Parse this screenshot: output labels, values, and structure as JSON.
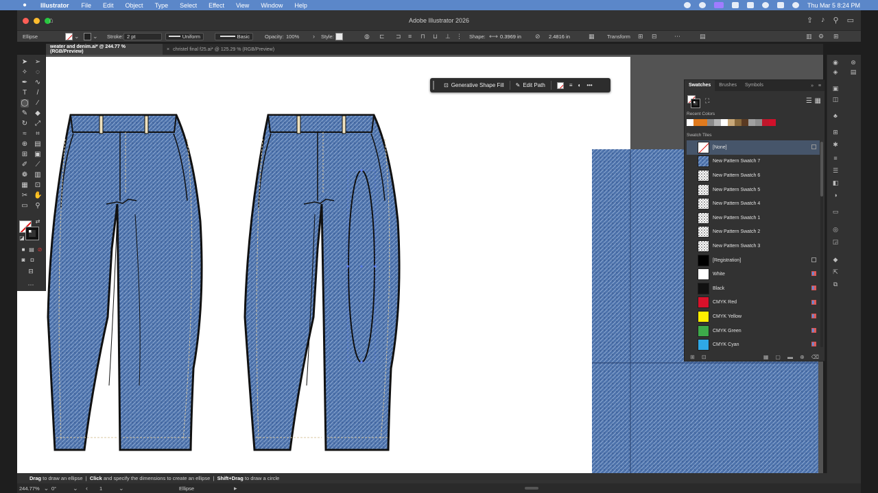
{
  "menubar": {
    "app": "Illustrator",
    "items": [
      "File",
      "Edit",
      "Object",
      "Type",
      "Select",
      "Effect",
      "View",
      "Window",
      "Help"
    ],
    "datetime": "Thu Mar 5  8:24 PM"
  },
  "window": {
    "title": "Adobe Illustrator 2026"
  },
  "control": {
    "object_type": "Ellipse",
    "stroke_label": "Stroke:",
    "stroke_value": "2 pt",
    "profile": "Uniform",
    "brush": "Basic",
    "opacity_label": "Opacity:",
    "opacity_value": "100%",
    "style_label": "Style:",
    "shape_label": "Shape:",
    "width": "0.3969 in",
    "height": "2.4816 in",
    "transform": "Transform"
  },
  "tabs": [
    {
      "label": "weater and denim.ai* @ 244.77 % (RGB/Preview)",
      "active": true
    },
    {
      "label": "christel final f25.ai* @ 125.29 % (RGB/Preview)",
      "active": false
    }
  ],
  "taskbar": {
    "generative": "Generative Shape Fill",
    "edit_path": "Edit Path"
  },
  "swatches_panel": {
    "tabs": [
      "Swatches",
      "Brushes",
      "Symbols"
    ],
    "recent_label": "Recent Colors",
    "recent_colors": [
      "#ffffff",
      "#e07a1d",
      "#e07a1d",
      "#8b8b8b",
      "#b5b5b5",
      "#ffffff",
      "#c9a97a",
      "#8a6a3d",
      "#5a3a22",
      "#a0a0a0",
      "#8f8f8f",
      "#c0172b",
      "#d0102a"
    ],
    "tiles_label": "Swatch Tiles",
    "rows": [
      {
        "label": "[None]",
        "kind": "none",
        "selected": true
      },
      {
        "label": "New Pattern Swatch 7",
        "kind": "denim"
      },
      {
        "label": "New Pattern Swatch 6",
        "kind": "pattern"
      },
      {
        "label": "New Pattern Swatch 5",
        "kind": "pattern"
      },
      {
        "label": "New Pattern Swatch 4",
        "kind": "pattern"
      },
      {
        "label": "New Pattern Swatch 1",
        "kind": "pattern"
      },
      {
        "label": "New Pattern Swatch 2",
        "kind": "pattern"
      },
      {
        "label": "New Pattern Swatch 3",
        "kind": "pattern"
      },
      {
        "label": "[Registration]",
        "kind": "color",
        "color": "#000000",
        "icon": "registration"
      },
      {
        "label": "White",
        "kind": "color",
        "color": "#ffffff",
        "icon": "cmyk"
      },
      {
        "label": "Black",
        "kind": "color",
        "color": "#111111",
        "icon": "cmyk"
      },
      {
        "label": "CMYK Red",
        "kind": "color",
        "color": "#d8112a",
        "icon": "cmyk"
      },
      {
        "label": "CMYK Yellow",
        "kind": "color",
        "color": "#ffee00",
        "icon": "cmyk"
      },
      {
        "label": "CMYK Green",
        "kind": "color",
        "color": "#3daa4a",
        "icon": "cmyk"
      },
      {
        "label": "CMYK Cyan",
        "kind": "color",
        "color": "#2fa8e6",
        "icon": "cmyk"
      }
    ]
  },
  "status": {
    "k1": "Drag",
    "t1": " to draw an ellipse  |  ",
    "k2": "Click",
    "t2": " and specify the dimensions to create an ellipse  |  ",
    "k3": "Shift+Drag",
    "t3": " to draw a circle"
  },
  "bottom": {
    "zoom": "244.77%",
    "rotation": "0°",
    "artboard": "1",
    "tool": "Ellipse"
  },
  "colors": {
    "menubar": "#5b87c9",
    "denim": "#4a6fa8",
    "selection": "#46556a"
  }
}
